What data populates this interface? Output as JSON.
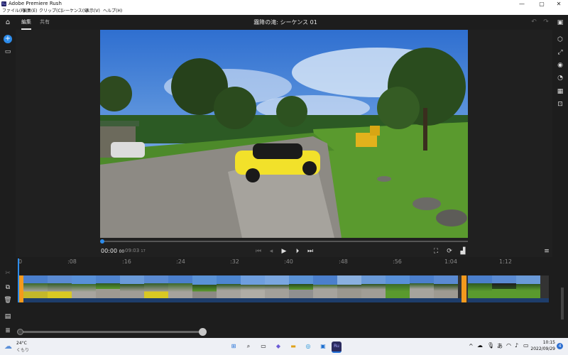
{
  "window": {
    "title": "Adobe Premiere Rush",
    "app_icon": "Ru",
    "controls": {
      "minimize": "—",
      "maximize": "▢",
      "close": "✕"
    }
  },
  "menu": [
    "ファイル(F)",
    "編集(E)",
    "クリップ(C)",
    "シーケンス(S)",
    "表示(V)",
    "ヘルプ(H)"
  ],
  "topbar": {
    "tabs": [
      "編集",
      "共有"
    ],
    "sequence_title": "霧降の滝: シーケンス 01"
  },
  "player": {
    "timecode": "00:00",
    "timecode_frames": "00",
    "duration": "09:03",
    "duration_frames": "17"
  },
  "timeline": {
    "ticks": [
      "0",
      ":08",
      ":16",
      ":24",
      ":32",
      ":40",
      ":48",
      ":56",
      "1:04",
      "1:12"
    ]
  },
  "taskbar": {
    "weather_temp": "24°C",
    "weather_desc": "くもり",
    "time": "10:15",
    "date": "2022/09/29",
    "notifications": "4",
    "ime": "あ"
  },
  "colors": {
    "accent": "#2d8ceb",
    "clip_handle": "#f39a1e",
    "car": "#f2e12a"
  }
}
